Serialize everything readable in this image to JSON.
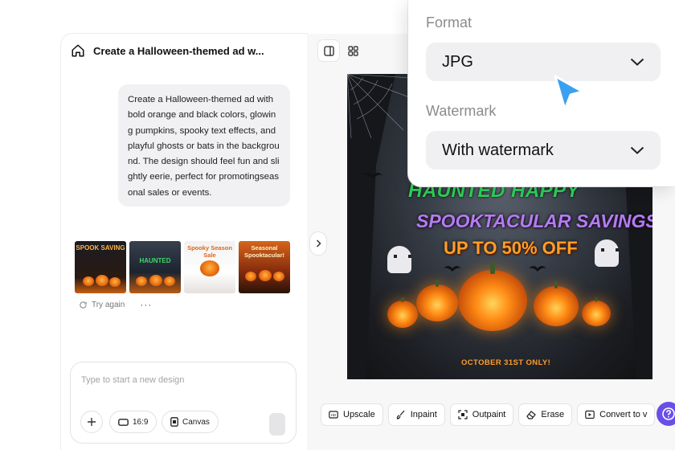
{
  "chat": {
    "title": "Create a Halloween-themed ad w...",
    "prompt": "Create a Halloween-themed ad with bold orange and black colors, glowing pumpkins, spooky text effects, andplayful ghosts or bats in the background. The design should feel fun and slightly eerie, perfect for promotingseasonal sales or events.",
    "thumbnails": [
      {
        "label": "SPOOK SAVING"
      },
      {
        "label": "HAUNTED"
      },
      {
        "label": "Spooky Season Sale"
      },
      {
        "label": "Seasonal Spooktacular!"
      }
    ],
    "try_again": "Try again",
    "more": "···",
    "input_placeholder": "Type to start a new design",
    "ratio_label": "16:9",
    "canvas_label": "Canvas"
  },
  "poster": {
    "headline": "HAUNTED HAPPY",
    "subheadline": "SPOOKTACULAR SAVINGS!",
    "offer": "UP TO 50% OFF",
    "date_line": "OCTOBER 31ST ONLY!"
  },
  "toolbar": {
    "upscale": "Upscale",
    "inpaint": "Inpaint",
    "outpaint": "Outpaint",
    "erase": "Erase",
    "convert": "Convert to v"
  },
  "popover": {
    "format_label": "Format",
    "format_value": "JPG",
    "watermark_label": "Watermark",
    "watermark_value": "With watermark"
  },
  "colors": {
    "accent": "#6a4ee8",
    "cursor": "#3aa0f0",
    "pumpkin": "#ff8a14"
  }
}
